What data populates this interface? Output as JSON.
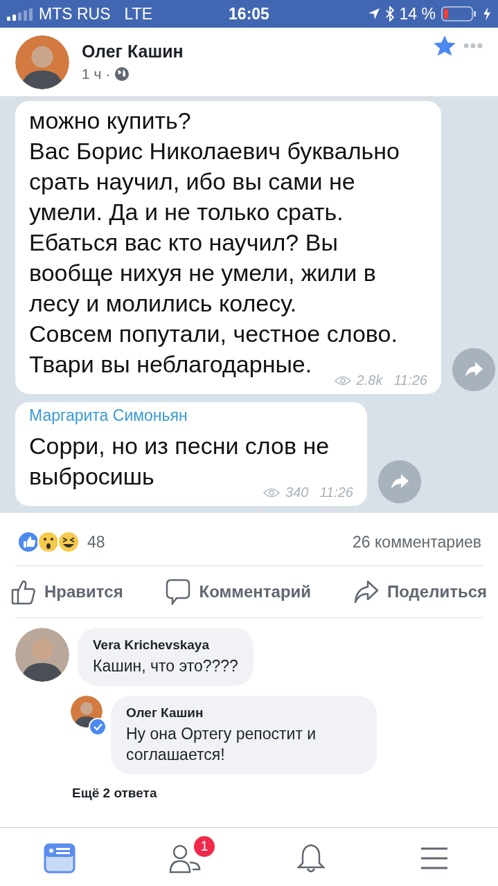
{
  "status_bar": {
    "carrier": "MTS RUS",
    "network": "LTE",
    "time": "16:05",
    "battery_text": "14 %"
  },
  "post": {
    "author": "Олег Кашин",
    "time": "1 ч",
    "separator": "·",
    "starred": true
  },
  "telegram": {
    "messages": [
      {
        "text": "можно купить?\nВас Борис Николаевич буквально срать научил, ибо вы сами не умели. Да и не только срать. Ебаться вас кто научил? Вы вообще нихуя не умели, жили в лесу и молились колесу.\nСовсем попутали, честное слово.\nТвари вы неблагодарные.",
        "views": "2.8k",
        "time": "11:26"
      },
      {
        "sender": "Маргарита Симоньян",
        "text": "Сорри, но из песни слов не выбросишь",
        "views": "340",
        "time": "11:26"
      }
    ]
  },
  "reactions": {
    "count": "48",
    "comments": "26 комментариев"
  },
  "actions": [
    {
      "kind": "like",
      "label": "Нравится"
    },
    {
      "kind": "comment",
      "label": "Комментарий"
    },
    {
      "kind": "share",
      "label": "Поделиться"
    }
  ],
  "comments": [
    {
      "name": "Vera Krichevskaya",
      "text": "Кашин, что это????",
      "verified": false,
      "children": [
        {
          "name": "Олег Кашин",
          "text": "Ну она Ортегу репостит и соглашается!",
          "verified": true
        }
      ]
    }
  ],
  "more_replies": "Ещё 2 ответа",
  "nav": [
    {
      "kind": "feed",
      "selected": true
    },
    {
      "kind": "friends",
      "selected": false,
      "badge": "1"
    },
    {
      "kind": "bell",
      "selected": false
    },
    {
      "kind": "menu",
      "selected": false
    }
  ]
}
